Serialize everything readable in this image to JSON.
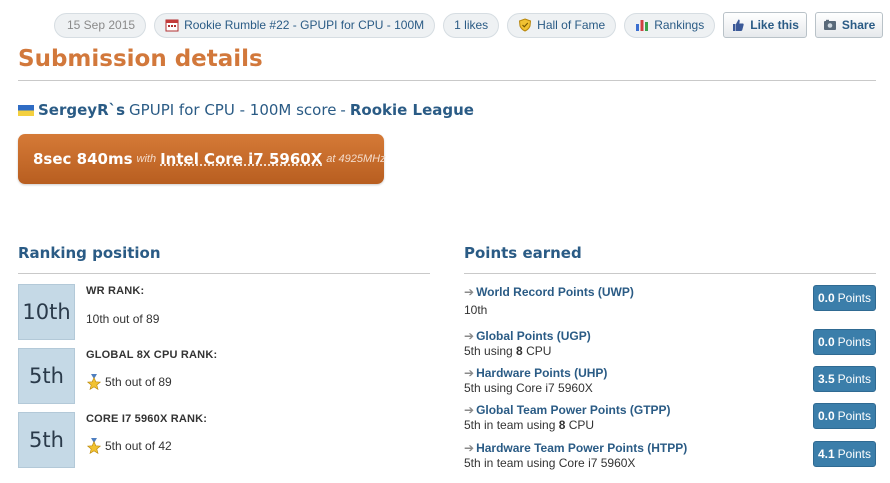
{
  "topbar": {
    "date": "15 Sep 2015",
    "competition": "Rookie Rumble #22 - GPUPI for CPU - 100M",
    "likes": "1 likes",
    "hall_of_fame": "Hall of Fame",
    "rankings": "Rankings",
    "like_this": "Like this",
    "share": "Share"
  },
  "page": {
    "title": "Submission details",
    "user": "SergeyR`s",
    "benchmark": "GPUPI for CPU - 100M score",
    "dash": " - ",
    "league": "Rookie League"
  },
  "score": {
    "value": "8sec 840ms",
    "with": "with",
    "cpu": "Intel Core i7 5960X",
    "at": "at 4925MHz"
  },
  "ranking": {
    "heading": "Ranking position",
    "items": [
      {
        "position": "10th",
        "label": "WR RANK:",
        "value": "10th out of 89",
        "star": false
      },
      {
        "position": "5th",
        "label": "GLOBAL 8X CPU RANK:",
        "value": "5th out of 89",
        "star": true
      },
      {
        "position": "5th",
        "label": "CORE I7 5960X RANK:",
        "value": "5th out of 42",
        "star": true
      }
    ]
  },
  "points": {
    "heading": "Points earned",
    "unit": "Points",
    "items": [
      {
        "name": "World Record Points (UWP)",
        "desc_pre": "10th",
        "desc_bold": "",
        "desc_post": "",
        "value": "0.0"
      },
      {
        "name": "Global Points (UGP)",
        "desc_pre": "5th using ",
        "desc_bold": "8",
        "desc_post": " CPU",
        "value": "0.0"
      },
      {
        "name": "Hardware Points (UHP)",
        "desc_pre": "5th using Core i7 5960X",
        "desc_bold": "",
        "desc_post": "",
        "value": "3.5"
      },
      {
        "name": "Global Team Power Points (GTPP)",
        "desc_pre": "5th in team using ",
        "desc_bold": "8",
        "desc_post": " CPU",
        "value": "0.0"
      },
      {
        "name": "Hardware Team Power Points (HTPP)",
        "desc_pre": "5th in team using Core i7 5960X",
        "desc_bold": "",
        "desc_post": "",
        "value": "4.1"
      }
    ]
  },
  "colors": {
    "accent_orange": "#d2783b",
    "link_blue": "#2a5b85",
    "badge_blue": "#3b7eaa",
    "rank_box": "#c5d9e6"
  }
}
